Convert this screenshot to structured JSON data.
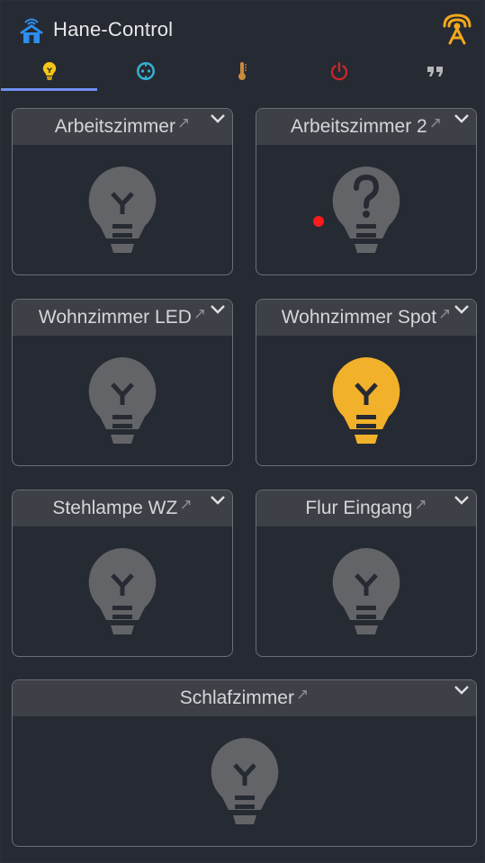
{
  "app": {
    "title": "Hane-Control",
    "accent_color": "#6f8ff0",
    "home_icon": "home-wifi-icon",
    "signal_icon": "signal-tower-icon"
  },
  "tabs": [
    {
      "id": "lights",
      "icon": "lightbulb-icon",
      "color": "#f5c518",
      "active": true
    },
    {
      "id": "sockets",
      "icon": "power-socket-icon",
      "color": "#34b1d3",
      "active": false
    },
    {
      "id": "temperature",
      "icon": "thermometer-icon",
      "color": "#c98a3a",
      "active": false
    },
    {
      "id": "power",
      "icon": "power-icon",
      "color": "#d32626",
      "active": false
    },
    {
      "id": "quotes",
      "icon": "quote-icon",
      "color": "#b5b5b8",
      "active": false
    }
  ],
  "cards": [
    {
      "title": "Arbeitszimmer",
      "state": "off"
    },
    {
      "title": "Arbeitszimmer 2",
      "state": "unknown"
    },
    {
      "title": "Wohnzimmer LED",
      "state": "off"
    },
    {
      "title": "Wohnzimmer Spot",
      "state": "on"
    },
    {
      "title": "Stehlampe WZ",
      "state": "off"
    },
    {
      "title": "Flur Eingang",
      "state": "off"
    },
    {
      "title": "Schlafzimmer",
      "state": "off"
    }
  ],
  "colors": {
    "bulb_off": "#636467",
    "bulb_on": "#f2b12a",
    "unknown_dot": "#ff1a1a"
  },
  "symbols": {
    "external_link": "↗"
  }
}
